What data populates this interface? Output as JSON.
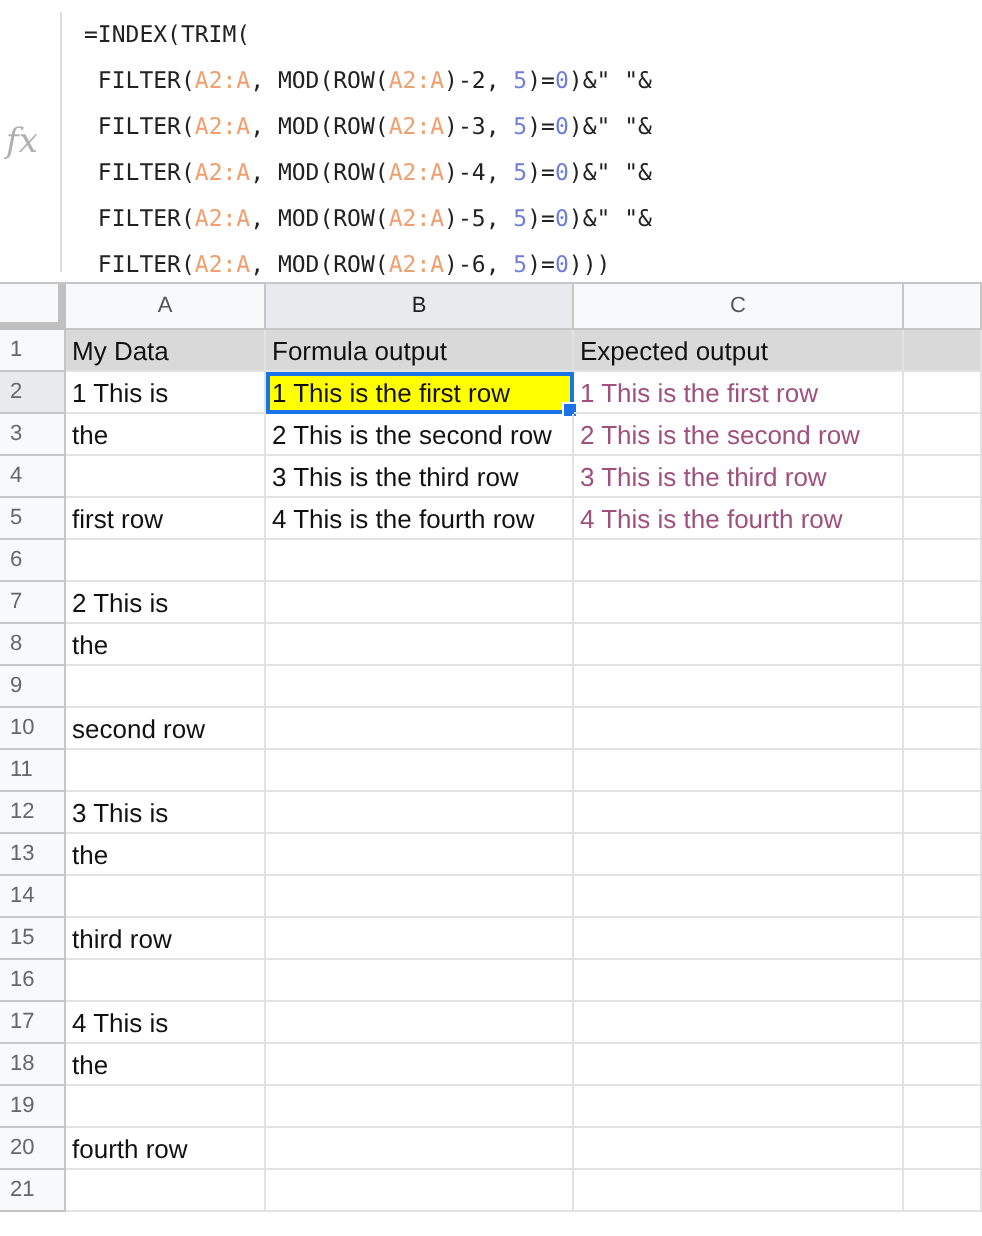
{
  "formula_bar": {
    "icon_label": "fx",
    "lines": [
      [
        {
          "text": "=INDEX(TRIM(",
          "kind": "plain"
        }
      ],
      [
        {
          "text": " FILTER(",
          "kind": "plain"
        },
        {
          "text": "A2:A",
          "kind": "range"
        },
        {
          "text": ", MOD(ROW(",
          "kind": "plain"
        },
        {
          "text": "A2:A",
          "kind": "range"
        },
        {
          "text": ")-2, ",
          "kind": "plain"
        },
        {
          "text": "5",
          "kind": "number"
        },
        {
          "text": ")=",
          "kind": "plain"
        },
        {
          "text": "0",
          "kind": "number"
        },
        {
          "text": ")&\" \"&",
          "kind": "plain"
        }
      ],
      [
        {
          "text": " FILTER(",
          "kind": "plain"
        },
        {
          "text": "A2:A",
          "kind": "range"
        },
        {
          "text": ", MOD(ROW(",
          "kind": "plain"
        },
        {
          "text": "A2:A",
          "kind": "range"
        },
        {
          "text": ")-3, ",
          "kind": "plain"
        },
        {
          "text": "5",
          "kind": "number"
        },
        {
          "text": ")=",
          "kind": "plain"
        },
        {
          "text": "0",
          "kind": "number"
        },
        {
          "text": ")&\" \"&",
          "kind": "plain"
        }
      ],
      [
        {
          "text": " FILTER(",
          "kind": "plain"
        },
        {
          "text": "A2:A",
          "kind": "range"
        },
        {
          "text": ", MOD(ROW(",
          "kind": "plain"
        },
        {
          "text": "A2:A",
          "kind": "range"
        },
        {
          "text": ")-4, ",
          "kind": "plain"
        },
        {
          "text": "5",
          "kind": "number"
        },
        {
          "text": ")=",
          "kind": "plain"
        },
        {
          "text": "0",
          "kind": "number"
        },
        {
          "text": ")&\" \"&",
          "kind": "plain"
        }
      ],
      [
        {
          "text": " FILTER(",
          "kind": "plain"
        },
        {
          "text": "A2:A",
          "kind": "range"
        },
        {
          "text": ", MOD(ROW(",
          "kind": "plain"
        },
        {
          "text": "A2:A",
          "kind": "range"
        },
        {
          "text": ")-5, ",
          "kind": "plain"
        },
        {
          "text": "5",
          "kind": "number"
        },
        {
          "text": ")=",
          "kind": "plain"
        },
        {
          "text": "0",
          "kind": "number"
        },
        {
          "text": ")&\" \"&",
          "kind": "plain"
        }
      ],
      [
        {
          "text": " FILTER(",
          "kind": "plain"
        },
        {
          "text": "A2:A",
          "kind": "range"
        },
        {
          "text": ", MOD(ROW(",
          "kind": "plain"
        },
        {
          "text": "A2:A",
          "kind": "range"
        },
        {
          "text": ")-6, ",
          "kind": "plain"
        },
        {
          "text": "5",
          "kind": "number"
        },
        {
          "text": ")=",
          "kind": "plain"
        },
        {
          "text": "0",
          "kind": "number"
        },
        {
          "text": ")))",
          "kind": "plain"
        }
      ]
    ]
  },
  "columns": [
    {
      "label": "A",
      "selected": false
    },
    {
      "label": "B",
      "selected": true
    },
    {
      "label": "C",
      "selected": false
    }
  ],
  "rows": [
    {
      "number": "1",
      "kind": "header",
      "selected": false,
      "cells": [
        {
          "text": "My Data",
          "selected": false
        },
        {
          "text": "Formula output",
          "selected": false
        },
        {
          "text": "Expected output",
          "selected": false
        }
      ]
    },
    {
      "number": "2",
      "kind": "data",
      "selected": true,
      "cells": [
        {
          "text": "1 This is",
          "selected": false
        },
        {
          "text": "1 This is the first row",
          "selected": true
        },
        {
          "text": "1 This is the first row",
          "selected": false,
          "color": "#a0507e"
        }
      ]
    },
    {
      "number": "3",
      "kind": "data",
      "selected": false,
      "cells": [
        {
          "text": "the",
          "selected": false
        },
        {
          "text": "2 This is the second row",
          "selected": false
        },
        {
          "text": "2 This is the second row",
          "selected": false,
          "color": "#a0507e"
        }
      ]
    },
    {
      "number": "4",
      "kind": "data",
      "selected": false,
      "cells": [
        {
          "selected": false
        },
        {
          "text": "3 This is the third row",
          "selected": false
        },
        {
          "text": "3 This is the third row",
          "selected": false,
          "color": "#a0507e"
        }
      ]
    },
    {
      "number": "5",
      "kind": "data",
      "selected": false,
      "cells": [
        {
          "text": "first row",
          "selected": false
        },
        {
          "text": "4 This is the fourth row",
          "selected": false
        },
        {
          "text": "4 This is the fourth row",
          "selected": false,
          "color": "#a0507e"
        }
      ]
    },
    {
      "number": "6",
      "kind": "data",
      "selected": false,
      "cells": [
        {
          "selected": false
        },
        {
          "selected": false
        },
        {
          "selected": false
        }
      ]
    },
    {
      "number": "7",
      "kind": "data",
      "selected": false,
      "cells": [
        {
          "text": "2 This is",
          "selected": false
        },
        {
          "selected": false
        },
        {
          "selected": false
        }
      ]
    },
    {
      "number": "8",
      "kind": "data",
      "selected": false,
      "cells": [
        {
          "text": "the",
          "selected": false
        },
        {
          "selected": false
        },
        {
          "selected": false
        }
      ]
    },
    {
      "number": "9",
      "kind": "data",
      "selected": false,
      "cells": [
        {
          "selected": false
        },
        {
          "selected": false
        },
        {
          "selected": false
        }
      ]
    },
    {
      "number": "10",
      "kind": "data",
      "selected": false,
      "cells": [
        {
          "text": "second row",
          "selected": false
        },
        {
          "selected": false
        },
        {
          "selected": false
        }
      ]
    },
    {
      "number": "11",
      "kind": "data",
      "selected": false,
      "cells": [
        {
          "selected": false
        },
        {
          "selected": false
        },
        {
          "selected": false
        }
      ]
    },
    {
      "number": "12",
      "kind": "data",
      "selected": false,
      "cells": [
        {
          "text": "3 This is",
          "selected": false
        },
        {
          "selected": false
        },
        {
          "selected": false
        }
      ]
    },
    {
      "number": "13",
      "kind": "data",
      "selected": false,
      "cells": [
        {
          "text": "the",
          "selected": false
        },
        {
          "selected": false
        },
        {
          "selected": false
        }
      ]
    },
    {
      "number": "14",
      "kind": "data",
      "selected": false,
      "cells": [
        {
          "selected": false
        },
        {
          "selected": false
        },
        {
          "selected": false
        }
      ]
    },
    {
      "number": "15",
      "kind": "data",
      "selected": false,
      "cells": [
        {
          "text": "third row",
          "selected": false
        },
        {
          "selected": false
        },
        {
          "selected": false
        }
      ]
    },
    {
      "number": "16",
      "kind": "data",
      "selected": false,
      "cells": [
        {
          "selected": false
        },
        {
          "selected": false
        },
        {
          "selected": false
        }
      ]
    },
    {
      "number": "17",
      "kind": "data",
      "selected": false,
      "cells": [
        {
          "text": "4 This is",
          "selected": false
        },
        {
          "selected": false
        },
        {
          "selected": false
        }
      ]
    },
    {
      "number": "18",
      "kind": "data",
      "selected": false,
      "cells": [
        {
          "text": "the",
          "selected": false
        },
        {
          "selected": false
        },
        {
          "selected": false
        }
      ]
    },
    {
      "number": "19",
      "kind": "data",
      "selected": false,
      "cells": [
        {
          "selected": false
        },
        {
          "selected": false
        },
        {
          "selected": false
        }
      ]
    },
    {
      "number": "20",
      "kind": "data",
      "selected": false,
      "cells": [
        {
          "text": "fourth row",
          "selected": false
        },
        {
          "selected": false
        },
        {
          "selected": false
        }
      ]
    },
    {
      "number": "21",
      "kind": "data",
      "selected": false,
      "cells": [
        {
          "selected": false
        },
        {
          "selected": false
        },
        {
          "selected": false
        }
      ]
    }
  ]
}
